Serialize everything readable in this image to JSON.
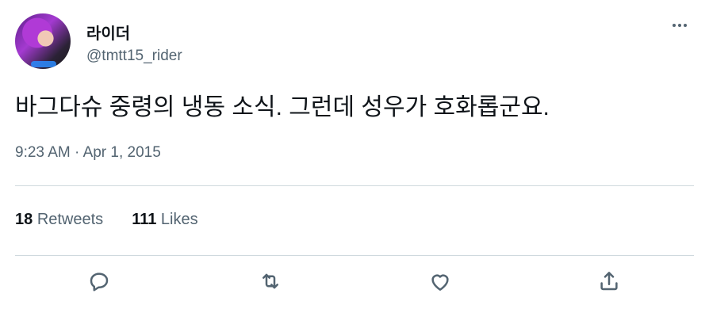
{
  "author": {
    "display_name": "라이더",
    "handle": "@tmtt15_rider"
  },
  "tweet": {
    "text": "바그다슈 중령의 냉동 소식. 그런데 성우가 호화롭군요.",
    "time": "9:23 AM",
    "separator": " · ",
    "date": "Apr 1, 2015"
  },
  "stats": {
    "retweets_count": "18",
    "retweets_label": "Retweets",
    "likes_count": "111",
    "likes_label": "Likes"
  },
  "icons": {
    "more": "more-icon",
    "reply": "reply-icon",
    "retweet": "retweet-icon",
    "like": "heart-icon",
    "share": "share-icon"
  }
}
